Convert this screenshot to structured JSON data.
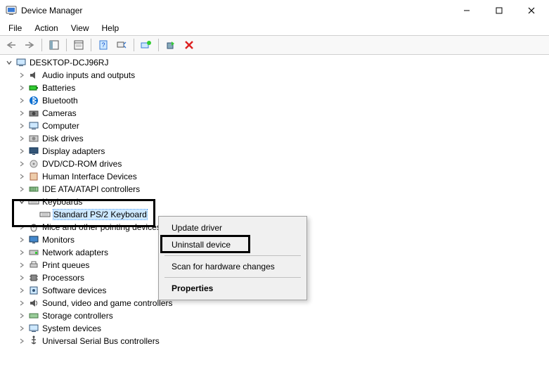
{
  "window": {
    "title": "Device Manager"
  },
  "menu": {
    "file": "File",
    "action": "Action",
    "view": "View",
    "help": "Help"
  },
  "tree": {
    "root": "DESKTOP-DCJ96RJ",
    "categories": [
      "Audio inputs and outputs",
      "Batteries",
      "Bluetooth",
      "Cameras",
      "Computer",
      "Disk drives",
      "Display adapters",
      "DVD/CD-ROM drives",
      "Human Interface Devices",
      "IDE ATA/ATAPI controllers",
      "Keyboards",
      "Mice and other pointing devices",
      "Monitors",
      "Network adapters",
      "Print queues",
      "Processors",
      "Software devices",
      "Sound, video and game controllers",
      "Storage controllers",
      "System devices",
      "Universal Serial Bus controllers"
    ],
    "keyboard_device": "Standard PS/2 Keyboard"
  },
  "context_menu": {
    "update": "Update driver",
    "uninstall": "Uninstall device",
    "scan": "Scan for hardware changes",
    "properties": "Properties"
  }
}
